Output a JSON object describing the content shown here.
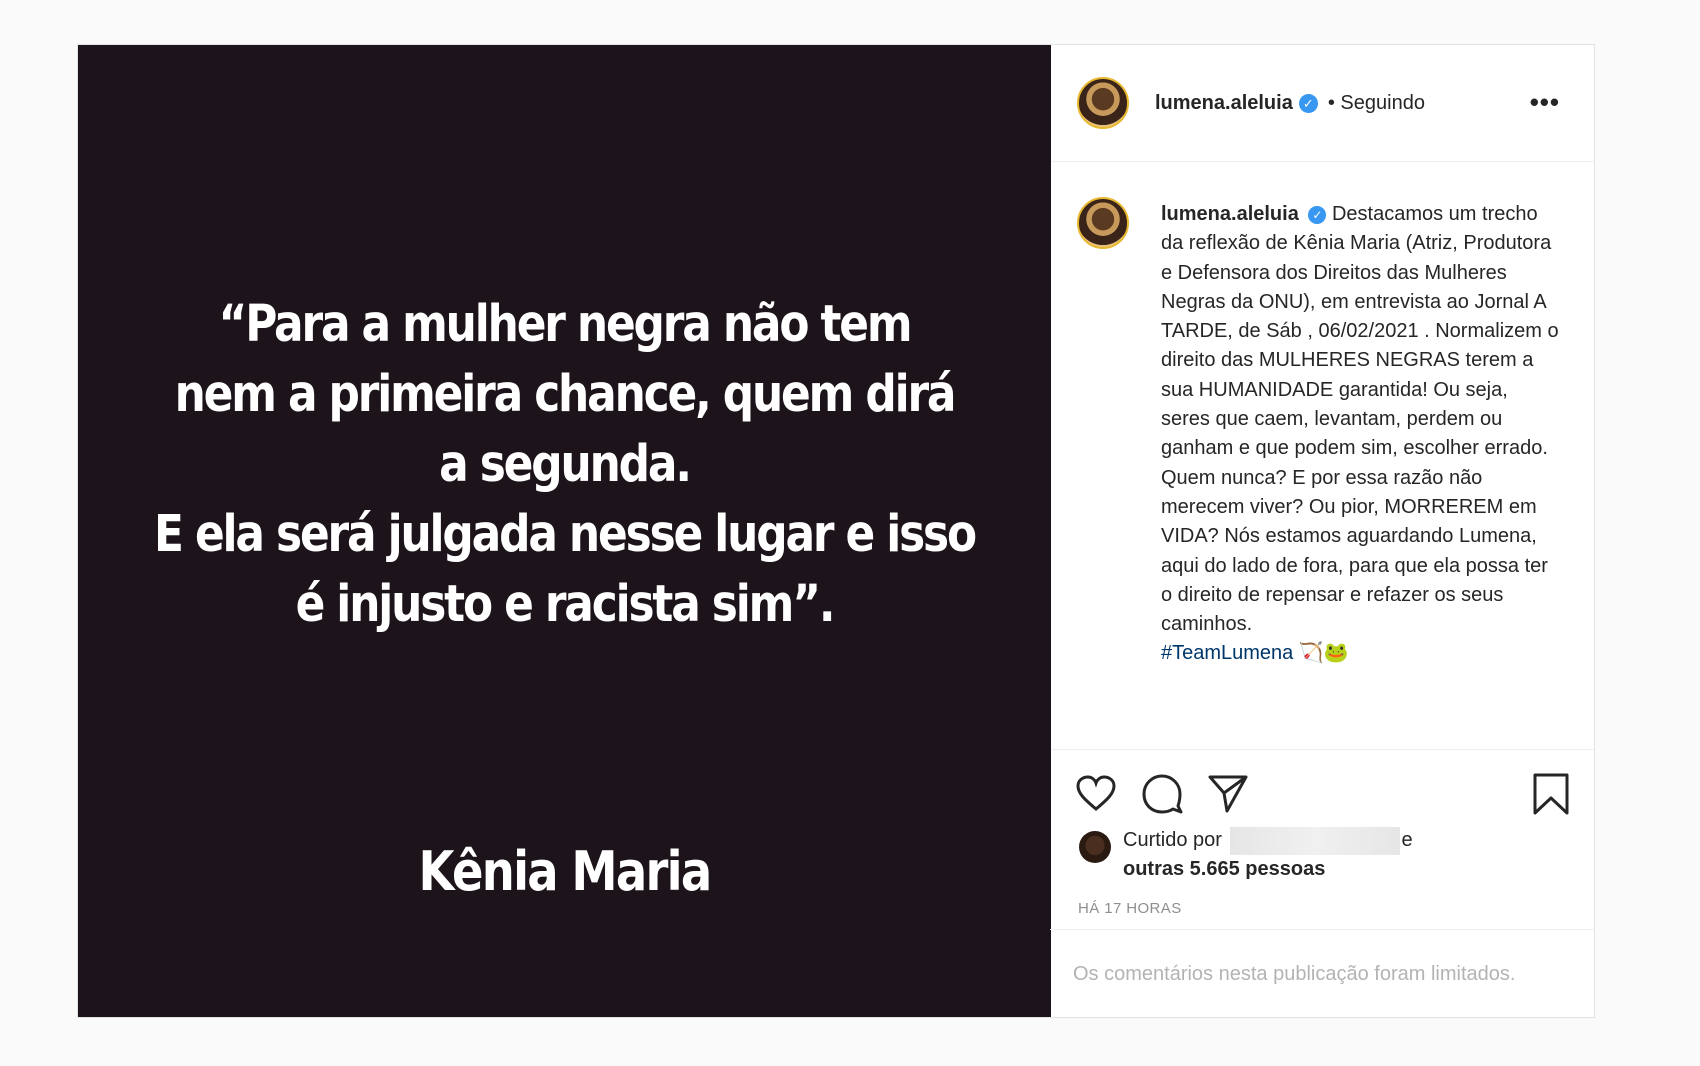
{
  "post": {
    "media": {
      "quote_lines": [
        "“Para a mulher negra não tem",
        "nem a primeira chance, quem dirá",
        "a segunda.",
        "E ela será julgada nesse lugar e isso",
        "é injusto e racista sim”."
      ],
      "author": "Kênia Maria",
      "background_color": "#1c141a"
    },
    "header": {
      "username": "lumena.aleluia",
      "verified_icon": "verified-badge-icon",
      "separator": "•",
      "follow_status": "Seguindo",
      "more_icon": "more-options-icon"
    },
    "caption": {
      "username": "lumena.aleluia",
      "text": "Destacamos um trecho da reflexão de Kênia Maria (Atriz, Produtora e Defensora dos Direitos das Mulheres Negras da ONU), em entrevista ao Jornal A TARDE, de Sáb , 06/02/2021 . Normalizem o direito das MULHERES NEGRAS terem a sua HUMANIDADE garantida! Ou seja, seres que caem, levantam, perdem ou ganham e que podem sim, escolher errado. Quem nunca? E por essa razão não merecem viver? Ou pior, MORREREM em VIDA? Nós estamos aguardando Lumena, aqui do lado de fora, para que ela possa ter o direito de repensar e refazer os seus caminhos.",
      "hashtag": "#TeamLumena",
      "emojis": "🏹🐸"
    },
    "actions": {
      "like_icon": "heart-icon",
      "comment_icon": "comment-icon",
      "share_icon": "share-icon",
      "save_icon": "bookmark-icon"
    },
    "likes": {
      "prefix": "Curtido por",
      "suffix": "e",
      "others": "outras 5.665 pessoas"
    },
    "timestamp": "HÁ 17 HORAS",
    "comments_notice": "Os comentários nesta publicação foram limitados."
  }
}
